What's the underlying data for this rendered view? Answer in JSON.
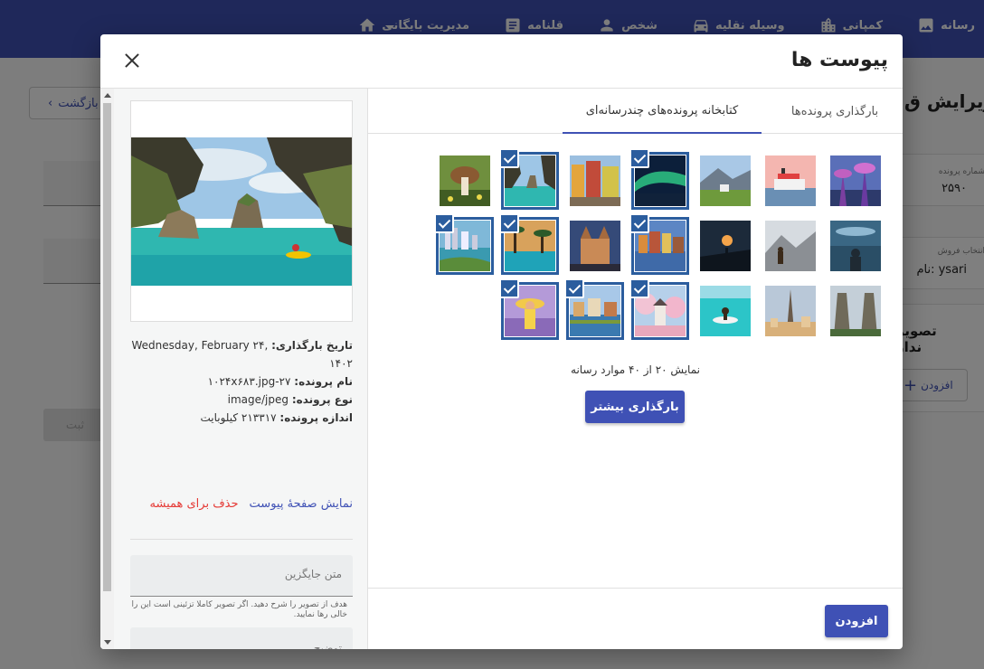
{
  "topbar": {
    "items": [
      {
        "label": "مدیریت بایگانی",
        "icon": "home-icon"
      },
      {
        "label": "قلنامه",
        "icon": "article-icon"
      },
      {
        "label": "شخص",
        "icon": "person-icon"
      },
      {
        "label": "وسیله نقلیه",
        "icon": "car-icon"
      },
      {
        "label": "کمپانی",
        "icon": "building-icon"
      },
      {
        "label": "رسانه",
        "icon": "image-icon"
      }
    ],
    "color": "#3f51b5"
  },
  "background": {
    "title": "ویرایش ق",
    "back_label": "بازگشت",
    "submit_label": "ثبت",
    "card1_label": "شماره پرونده",
    "card1_value": "۲۵۹۰",
    "card2_label": "انتخاب فروش",
    "card2_value": "نام: ysari",
    "card3_label": "تصویر ندار",
    "add_label": "افزودن"
  },
  "dialog": {
    "title": "پیوست ها",
    "tabs": {
      "upload": "بارگذاری پرونده‌ها",
      "library": "کتابخانه پرونده‌های چندرسانه‌ای"
    },
    "thumbnails": [
      {
        "scene": "supertrees",
        "selected": false
      },
      {
        "scene": "cruise",
        "selected": false
      },
      {
        "scene": "mountain-field",
        "selected": false
      },
      {
        "scene": "aurora",
        "selected": true
      },
      {
        "scene": "colorful-street",
        "selected": false
      },
      {
        "scene": "bay-cliffs",
        "selected": true
      },
      {
        "scene": "mushroom",
        "selected": false
      },
      {
        "scene": "lake-man",
        "selected": false
      },
      {
        "scene": "hiker-mountain",
        "selected": false
      },
      {
        "scene": "sunset-silhouette",
        "selected": false
      },
      {
        "scene": "canal-city",
        "selected": true
      },
      {
        "scene": "castle",
        "selected": false
      },
      {
        "scene": "palm-pool",
        "selected": true
      },
      {
        "scene": "aerial-city",
        "selected": true
      },
      {
        "scene": "temple-gate",
        "selected": false
      },
      {
        "scene": "eiffel",
        "selected": false
      },
      {
        "scene": "paddle-sea",
        "selected": false
      },
      {
        "scene": "cherry-blossom",
        "selected": true
      },
      {
        "scene": "river-town",
        "selected": true
      },
      {
        "scene": "yellow-hat",
        "selected": true
      }
    ],
    "count_text": "نمایش ۲۰ از ۴۰ موارد رسانه",
    "load_more": "بارگذاری بیشتر",
    "add_button": "افزودن",
    "details": {
      "upload_date_label": "تاریخ بارگذاری:",
      "upload_date_value": "Wednesday, February ۲۴, ۱۴۰۲",
      "file_name_label": "نام پرونده:",
      "file_name_value": "۲۷-۱۰۲۴x۶۸۳.jpg",
      "file_type_label": "نوع پرونده:",
      "file_type_value": "image/jpeg",
      "file_size_label": "اندازه پرونده:",
      "file_size_value": "۲۱۳۳۱۷ کیلوبایت",
      "view_link": "نمایش صفحهٔ پیوست",
      "delete_link": "حذف برای همیشه",
      "alt_placeholder": "متن جایگزین",
      "alt_help": "هدف از تصویر را شرح دهید. اگر تصویر کاملا تزئینی است این را خالی رها نمایید.",
      "description_placeholder": "توضیح"
    }
  }
}
